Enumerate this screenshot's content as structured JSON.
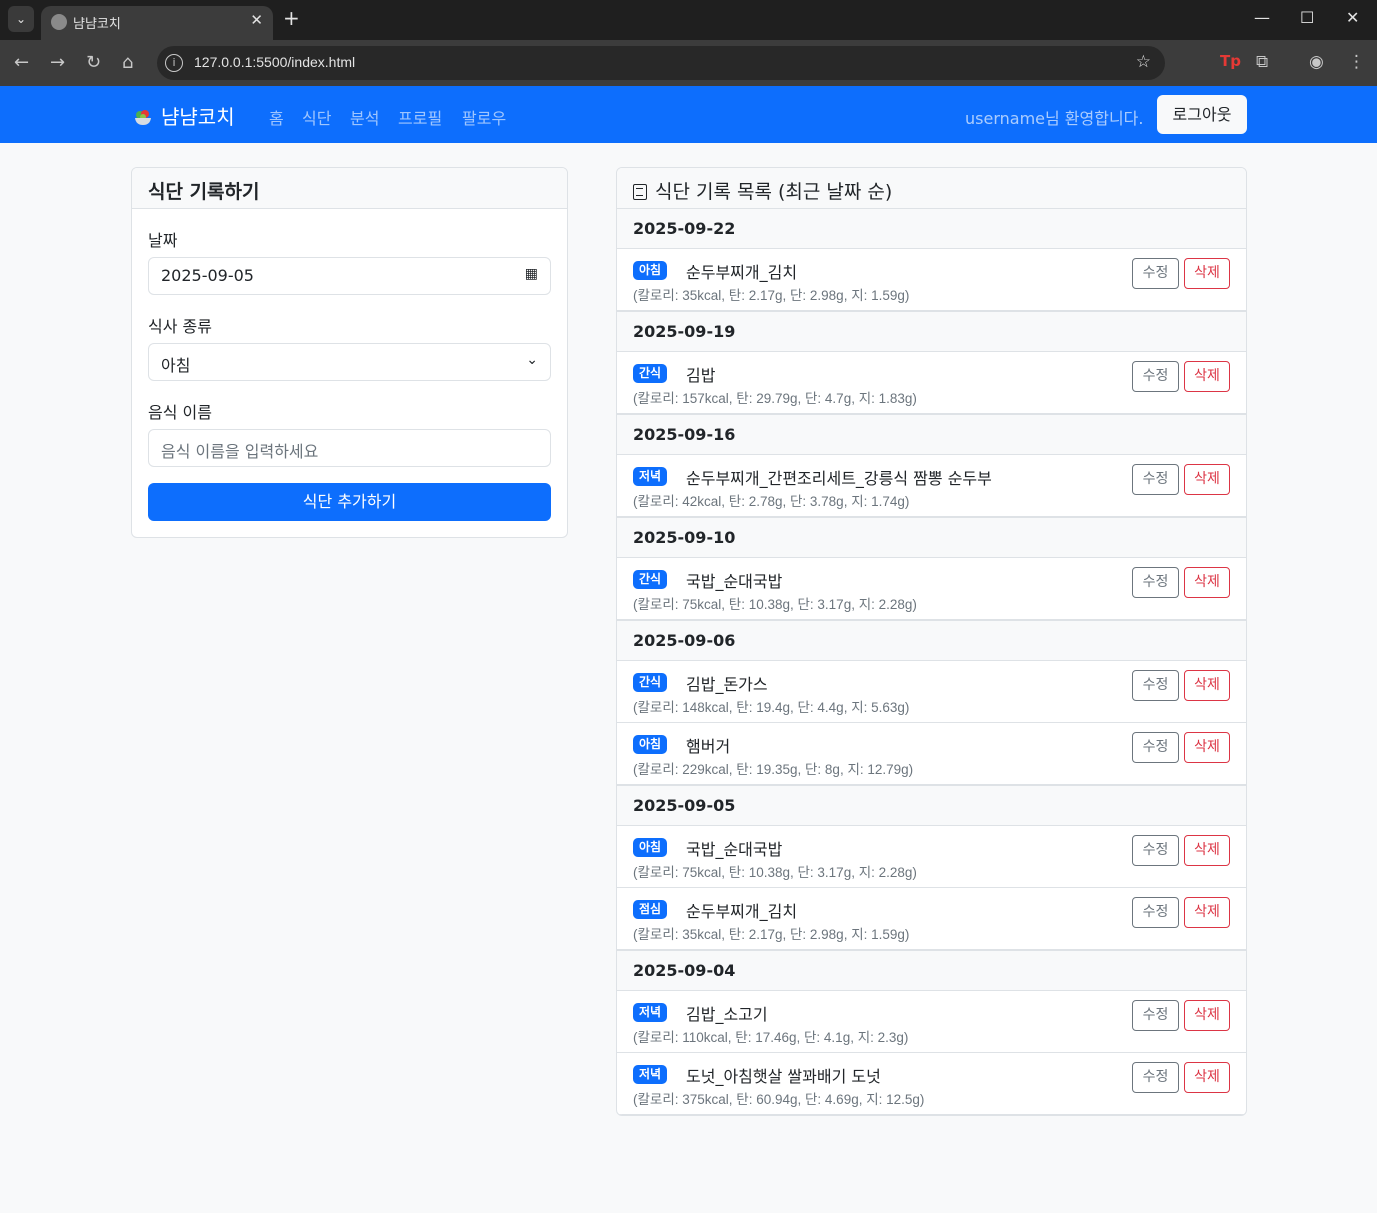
{
  "browser": {
    "tab_title": "냠냠코치",
    "url": "127.0.0.1:5500/index.html"
  },
  "navbar": {
    "brand": "냠냠코치",
    "links": [
      "홈",
      "식단",
      "분석",
      "프로필",
      "팔로우"
    ],
    "welcome": "username님 환영합니다.",
    "logout": "로그아웃"
  },
  "form": {
    "title": "식단 기록하기",
    "date_label": "날짜",
    "date_value": "2025-09-05",
    "meal_label": "식사 종류",
    "meal_value": "아침",
    "food_label": "음식 이름",
    "food_placeholder": "음식 이름을 입력하세요",
    "submit": "식단 추가하기"
  },
  "list": {
    "title": "식단 기록 목록 (최근 날짜 순)",
    "edit_label": "수정",
    "delete_label": "삭제",
    "groups": [
      {
        "date": "2025-09-22",
        "items": [
          {
            "meal": "아침",
            "food": "순두부찌개_김치",
            "nutrition": "(칼로리: 35kcal, 탄: 2.17g, 단: 2.98g, 지: 1.59g)"
          }
        ]
      },
      {
        "date": "2025-09-19",
        "items": [
          {
            "meal": "간식",
            "food": "김밥",
            "nutrition": "(칼로리: 157kcal, 탄: 29.79g, 단: 4.7g, 지: 1.83g)"
          }
        ]
      },
      {
        "date": "2025-09-16",
        "items": [
          {
            "meal": "저녁",
            "food": "순두부찌개_간편조리세트_강릉식 짬뽕 순두부",
            "nutrition": "(칼로리: 42kcal, 탄: 2.78g, 단: 3.78g, 지: 1.74g)"
          }
        ]
      },
      {
        "date": "2025-09-10",
        "items": [
          {
            "meal": "간식",
            "food": "국밥_순대국밥",
            "nutrition": "(칼로리: 75kcal, 탄: 10.38g, 단: 3.17g, 지: 2.28g)"
          }
        ]
      },
      {
        "date": "2025-09-06",
        "items": [
          {
            "meal": "간식",
            "food": "김밥_돈가스",
            "nutrition": "(칼로리: 148kcal, 탄: 19.4g, 단: 4.4g, 지: 5.63g)"
          },
          {
            "meal": "아침",
            "food": "햄버거",
            "nutrition": "(칼로리: 229kcal, 탄: 19.35g, 단: 8g, 지: 12.79g)"
          }
        ]
      },
      {
        "date": "2025-09-05",
        "items": [
          {
            "meal": "아침",
            "food": "국밥_순대국밥",
            "nutrition": "(칼로리: 75kcal, 탄: 10.38g, 단: 3.17g, 지: 2.28g)"
          },
          {
            "meal": "점심",
            "food": "순두부찌개_김치",
            "nutrition": "(칼로리: 35kcal, 탄: 2.17g, 단: 2.98g, 지: 1.59g)"
          }
        ]
      },
      {
        "date": "2025-09-04",
        "items": [
          {
            "meal": "저녁",
            "food": "김밥_소고기",
            "nutrition": "(칼로리: 110kcal, 탄: 17.46g, 단: 4.1g, 지: 2.3g)"
          },
          {
            "meal": "저녁",
            "food": "도넛_아침햇살 쌀꽈배기 도넛",
            "nutrition": "(칼로리: 375kcal, 탄: 60.94g, 단: 4.69g, 지: 12.5g)"
          }
        ]
      }
    ]
  }
}
